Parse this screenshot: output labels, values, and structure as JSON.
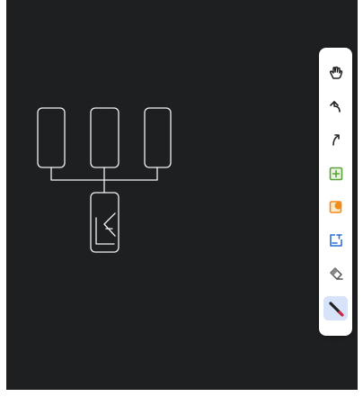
{
  "canvas": {
    "background": "#1e1f21",
    "stroke_color": "#f2f2f2",
    "handwritten_label": "LA"
  },
  "toolbar": {
    "tools": [
      {
        "name": "pan-hand-icon",
        "color": "#222222"
      },
      {
        "name": "undo-icon",
        "color": "#222222"
      },
      {
        "name": "redo-icon",
        "color": "#222222"
      },
      {
        "name": "add-frame-icon",
        "color": "#5aa13a"
      },
      {
        "name": "sticky-note-icon",
        "color": "#f08c1a"
      },
      {
        "name": "text-box-icon",
        "color": "#2a6fd6"
      },
      {
        "name": "eraser-icon",
        "color": "#555555"
      },
      {
        "name": "pen-icon",
        "color": "#222222",
        "accent": "#d4263e",
        "active": true
      }
    ]
  }
}
